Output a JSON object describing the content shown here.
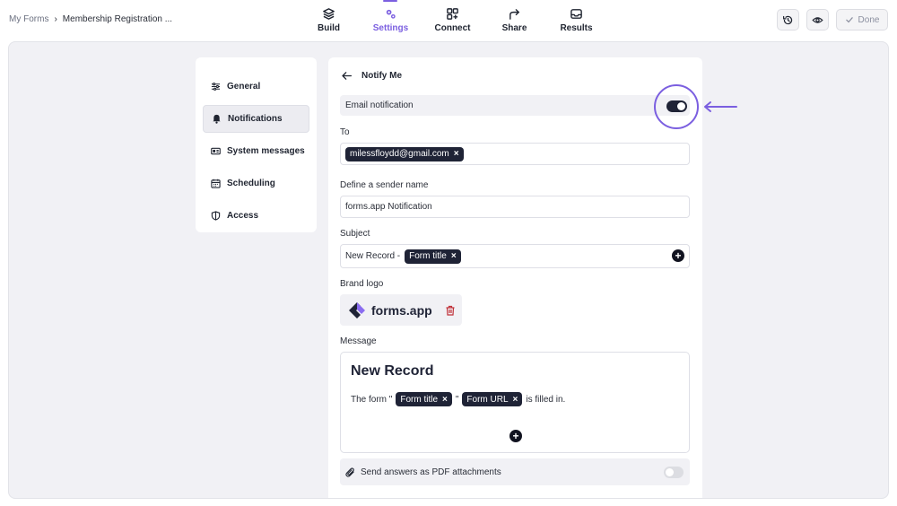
{
  "breadcrumb": {
    "root": "My Forms",
    "separator": "›",
    "current": "Membership Registration ..."
  },
  "nav": [
    {
      "label": "Build",
      "icon": "layers-icon"
    },
    {
      "label": "Settings",
      "icon": "gears-icon",
      "active": true
    },
    {
      "label": "Connect",
      "icon": "connect-icon"
    },
    {
      "label": "Share",
      "icon": "share-arrow-icon"
    },
    {
      "label": "Results",
      "icon": "inbox-icon"
    }
  ],
  "toolbar": {
    "history_icon": "history-icon",
    "preview_icon": "eye-icon",
    "done_label": "Done"
  },
  "sidebar": {
    "items": [
      {
        "label": "General",
        "icon": "sliders-icon"
      },
      {
        "label": "Notifications",
        "icon": "bell-icon",
        "active": true
      },
      {
        "label": "System messages",
        "icon": "message-card-icon"
      },
      {
        "label": "Scheduling",
        "icon": "calendar-icon"
      },
      {
        "label": "Access",
        "icon": "shield-icon"
      }
    ]
  },
  "panel": {
    "title": "Notify Me",
    "email_notification": {
      "label": "Email notification",
      "enabled": true
    },
    "to": {
      "label": "To",
      "recipients": [
        "milessfloydd@gmail.com"
      ]
    },
    "sender": {
      "label": "Define a sender name",
      "value": "forms.app Notification"
    },
    "subject": {
      "label": "Subject",
      "prefix": "New Record -",
      "tag": "Form title"
    },
    "brand_logo": {
      "label": "Brand logo",
      "logo_text": "forms.app"
    },
    "message": {
      "label": "Message",
      "heading": "New Record",
      "text_before": "The form \"",
      "tag1": "Form title",
      "quote": "\"",
      "tag2": "Form URL",
      "text_after": "is filled in."
    },
    "pdf": {
      "label": "Send answers as PDF attachments",
      "enabled": false
    }
  },
  "colors": {
    "accent": "#7b5fe0",
    "chip": "#1f2336",
    "canvas": "#f1f1f5"
  }
}
